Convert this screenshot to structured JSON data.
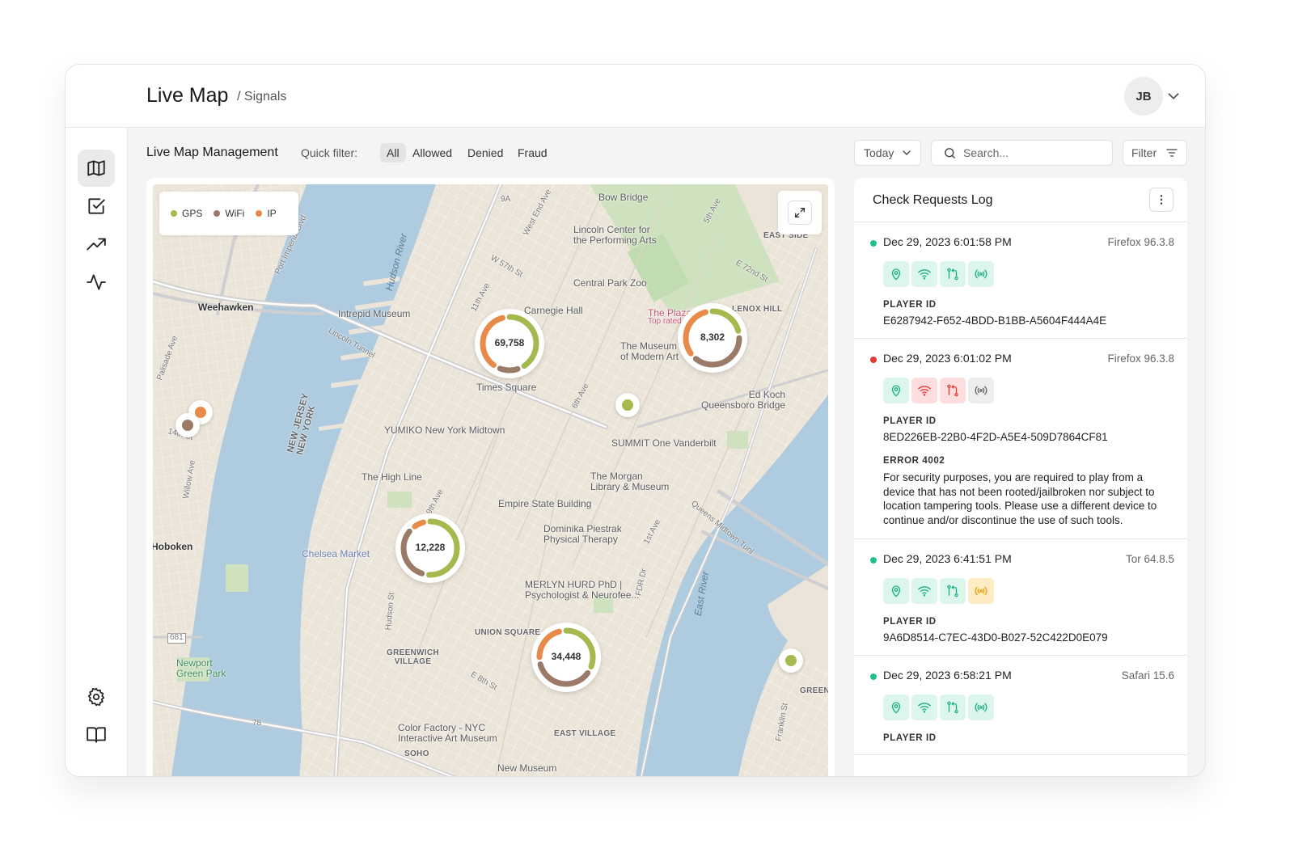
{
  "header": {
    "title": "Live Map",
    "breadcrumb": "/ Signals",
    "user_initials": "JB"
  },
  "sidebar": {
    "items": [
      {
        "name": "map",
        "icon": "map-icon",
        "active": true
      },
      {
        "name": "checks",
        "icon": "checkbox-icon",
        "active": false
      },
      {
        "name": "analytics",
        "icon": "trending-up-icon",
        "active": false
      },
      {
        "name": "activity",
        "icon": "activity-icon",
        "active": false
      }
    ],
    "bottom_items": [
      {
        "name": "settings",
        "icon": "gear-icon"
      },
      {
        "name": "docs",
        "icon": "book-icon"
      }
    ]
  },
  "toolbar": {
    "title": "Live Map Management",
    "quick_filter_label": "Quick filter:",
    "filters": [
      "All",
      "Allowed",
      "Denied",
      "Fraud"
    ],
    "active_filter": "All",
    "date_select": "Today",
    "search_placeholder": "Search...",
    "filter_button": "Filter"
  },
  "colors": {
    "gps": "#a6b94f",
    "wifi": "#9b7a68",
    "ip": "#e88a4a",
    "allowed": "#1ec28b",
    "denied": "#e53935"
  },
  "legend": [
    {
      "label": "GPS",
      "color": "#a6b94f"
    },
    {
      "label": "WiFi",
      "color": "#9b7a68"
    },
    {
      "label": "IP",
      "color": "#e88a4a"
    }
  ],
  "map": {
    "labels": {
      "bow_bridge": "Bow Bridge",
      "lincoln_center": "Lincoln Center for\nthe Performing Arts",
      "central_park_zoo": "Central Park Zoo",
      "weehawken": "Weehawken",
      "intrepid": "Intrepid Museum",
      "carnegie": "Carnegie Hall",
      "plaza": "The Plaza",
      "plaza_sub": "Top rated",
      "lenox_hill": "LENOX HILL",
      "moma": "The Museum\nof Modern Art",
      "times_square": "Times Square",
      "ed_koch": "Ed Koch\nQueensboro Bridge",
      "yumiko": "YUMIKO New York Midtown",
      "summit": "SUMMIT One Vanderbilt",
      "high_line": "The High Line",
      "morgan": "The Morgan\nLibrary & Museum",
      "new_jersey": "NEW JERSEY\nNEW YORK",
      "esb": "Empire State Building",
      "dominika": "Dominika Piestrak\nPhysical Therapy",
      "hoboken": "Hoboken",
      "chelsea_market": "Chelsea Market",
      "merlyn": "MERLYN HURD PhD |\nPsychologist & Neurofee...",
      "union_square": "UNION SQUARE",
      "greenwich": "GREENWICH\nVILLAGE",
      "newport": "Newport\nGreen Park",
      "color_factory": "Color Factory - NYC\nInteractive Art Museum",
      "east_village": "EAST VILLAGE",
      "soho": "SOHO",
      "new_museum": "New Museum",
      "greenpoint": "GREENP",
      "upper_east": "UP\nEAST SIDE",
      "hudson_river": "Hudson River",
      "east_river": "East River",
      "lincoln_tunnel": "Lincoln Tunnel",
      "fdr": "FDR Dr",
      "queens_midtown": "Queens Midtown Tunl",
      "w57": "W 57th St",
      "e72": "E 72nd St",
      "e8": "E 8th St",
      "palisade": "Palisade Ave",
      "willow": "Willow Ave",
      "port_imperial": "Port Imperial Blvd",
      "west_end": "West End Ave",
      "fifth_ave": "5th Ave",
      "eleventh_ave": "11th Ave",
      "sixth_ave": "6th Ave",
      "ninth_ave": "9th Ave",
      "first_ave": "1st Ave",
      "hudson_st": "Hudson St",
      "fourteenth": "14th St",
      "franklin": "Franklin St",
      "route_9a": "9A",
      "route_681": "681",
      "route_78": "78"
    },
    "clusters": [
      {
        "count": "69,758",
        "gps": 0.45,
        "wifi": 0.15,
        "ip": 0.4
      },
      {
        "count": "8,302",
        "gps": 0.25,
        "wifi": 0.4,
        "ip": 0.35
      },
      {
        "count": "12,228",
        "gps": 0.55,
        "wifi": 0.35,
        "ip": 0.1
      },
      {
        "count": "34,448",
        "gps": 0.35,
        "wifi": 0.4,
        "ip": 0.25
      }
    ],
    "pins": [
      {
        "type": "gps"
      },
      {
        "type": "ip"
      },
      {
        "type": "wifi"
      },
      {
        "type": "gps"
      }
    ]
  },
  "log": {
    "title": "Check Requests Log",
    "player_id_label": "PLAYER ID",
    "entries": [
      {
        "status": "allowed",
        "timestamp": "Dec 29, 2023 6:01:58 PM",
        "browser": "Firefox 96.3.8",
        "signals": [
          "ok",
          "ok",
          "ok",
          "ok"
        ],
        "player_id": "E6287942-F652-4BDD-B1BB-A5604F444A4E"
      },
      {
        "status": "denied",
        "timestamp": "Dec 29, 2023 6:01:02 PM",
        "browser": "Firefox 96.3.8",
        "signals": [
          "ok",
          "fail",
          "fail",
          "neutral"
        ],
        "player_id": "8ED226EB-22B0-4F2D-A5E4-509D7864CF81",
        "error_label": "ERROR 4002",
        "error_message": "For security purposes, you are required to play from a device that has not been rooted/jailbroken nor subject to location tampering tools. Please use a different device to continue and/or discontinue the use of such tools."
      },
      {
        "status": "allowed",
        "timestamp": "Dec 29, 2023 6:41:51 PM",
        "browser": "Tor 64.8.5",
        "signals": [
          "ok",
          "ok",
          "ok",
          "warn"
        ],
        "player_id": "9A6D8514-C7EC-43D0-B027-52C422D0E079"
      },
      {
        "status": "allowed",
        "timestamp": "Dec 29, 2023 6:58:21 PM",
        "browser": "Safari 15.6",
        "signals": [
          "ok",
          "ok",
          "ok",
          "ok"
        ]
      }
    ]
  }
}
